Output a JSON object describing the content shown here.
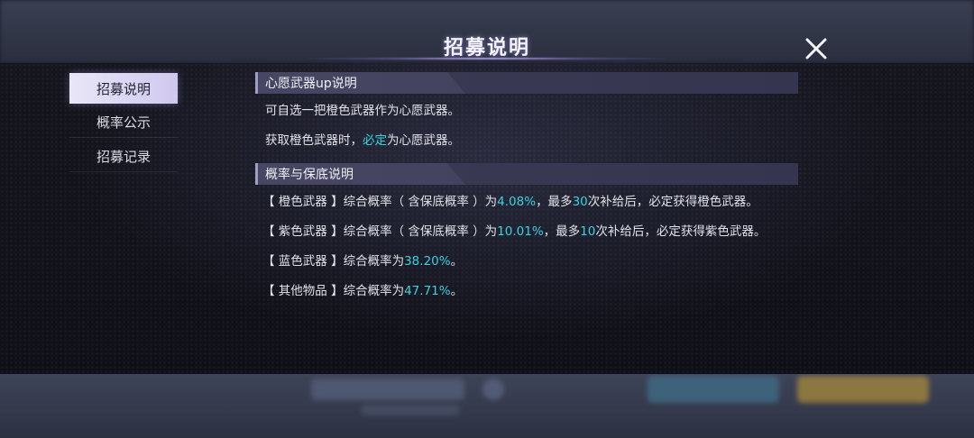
{
  "modal": {
    "title": "招募说明",
    "close_icon": "close-icon"
  },
  "nav": {
    "items": [
      {
        "label": "招募说明",
        "active": true
      },
      {
        "label": "概率公示",
        "active": false
      },
      {
        "label": "招募记录",
        "active": false
      }
    ]
  },
  "sections": [
    {
      "header": "心愿武器up说明",
      "lines": [
        {
          "parts": [
            {
              "text": "可自选一把橙色武器作为心愿武器。",
              "hl": false
            }
          ]
        },
        {
          "parts": [
            {
              "text": "获取橙色武器时，",
              "hl": false
            },
            {
              "text": "必定",
              "hl": true
            },
            {
              "text": "为心愿武器。",
              "hl": false
            }
          ]
        }
      ]
    },
    {
      "header": "概率与保底说明",
      "lines": [
        {
          "parts": [
            {
              "text": "【 橙色武器 】综合概率（ 含保底概率 ）为",
              "hl": false
            },
            {
              "text": "4.08%",
              "hl": true
            },
            {
              "text": "，最多",
              "hl": false
            },
            {
              "text": "30",
              "hl": true
            },
            {
              "text": "次补给后，必定获得橙色武器。",
              "hl": false
            }
          ]
        },
        {
          "parts": [
            {
              "text": "【 紫色武器 】综合概率（ 含保底概率 ）为",
              "hl": false
            },
            {
              "text": "10.01%",
              "hl": true
            },
            {
              "text": "，最多",
              "hl": false
            },
            {
              "text": "10",
              "hl": true
            },
            {
              "text": "次补给后，必定获得紫色武器。",
              "hl": false
            }
          ]
        },
        {
          "parts": [
            {
              "text": "【 蓝色武器 】综合概率为",
              "hl": false
            },
            {
              "text": "38.20%",
              "hl": true
            },
            {
              "text": "。",
              "hl": false
            }
          ]
        },
        {
          "parts": [
            {
              "text": "【 其他物品 】综合概率为",
              "hl": false
            },
            {
              "text": "47.71%",
              "hl": true
            },
            {
              "text": "。",
              "hl": false
            }
          ]
        }
      ]
    }
  ],
  "colors": {
    "highlight": "#3ad2de",
    "nav_active_bg": "#e9e6f8"
  }
}
